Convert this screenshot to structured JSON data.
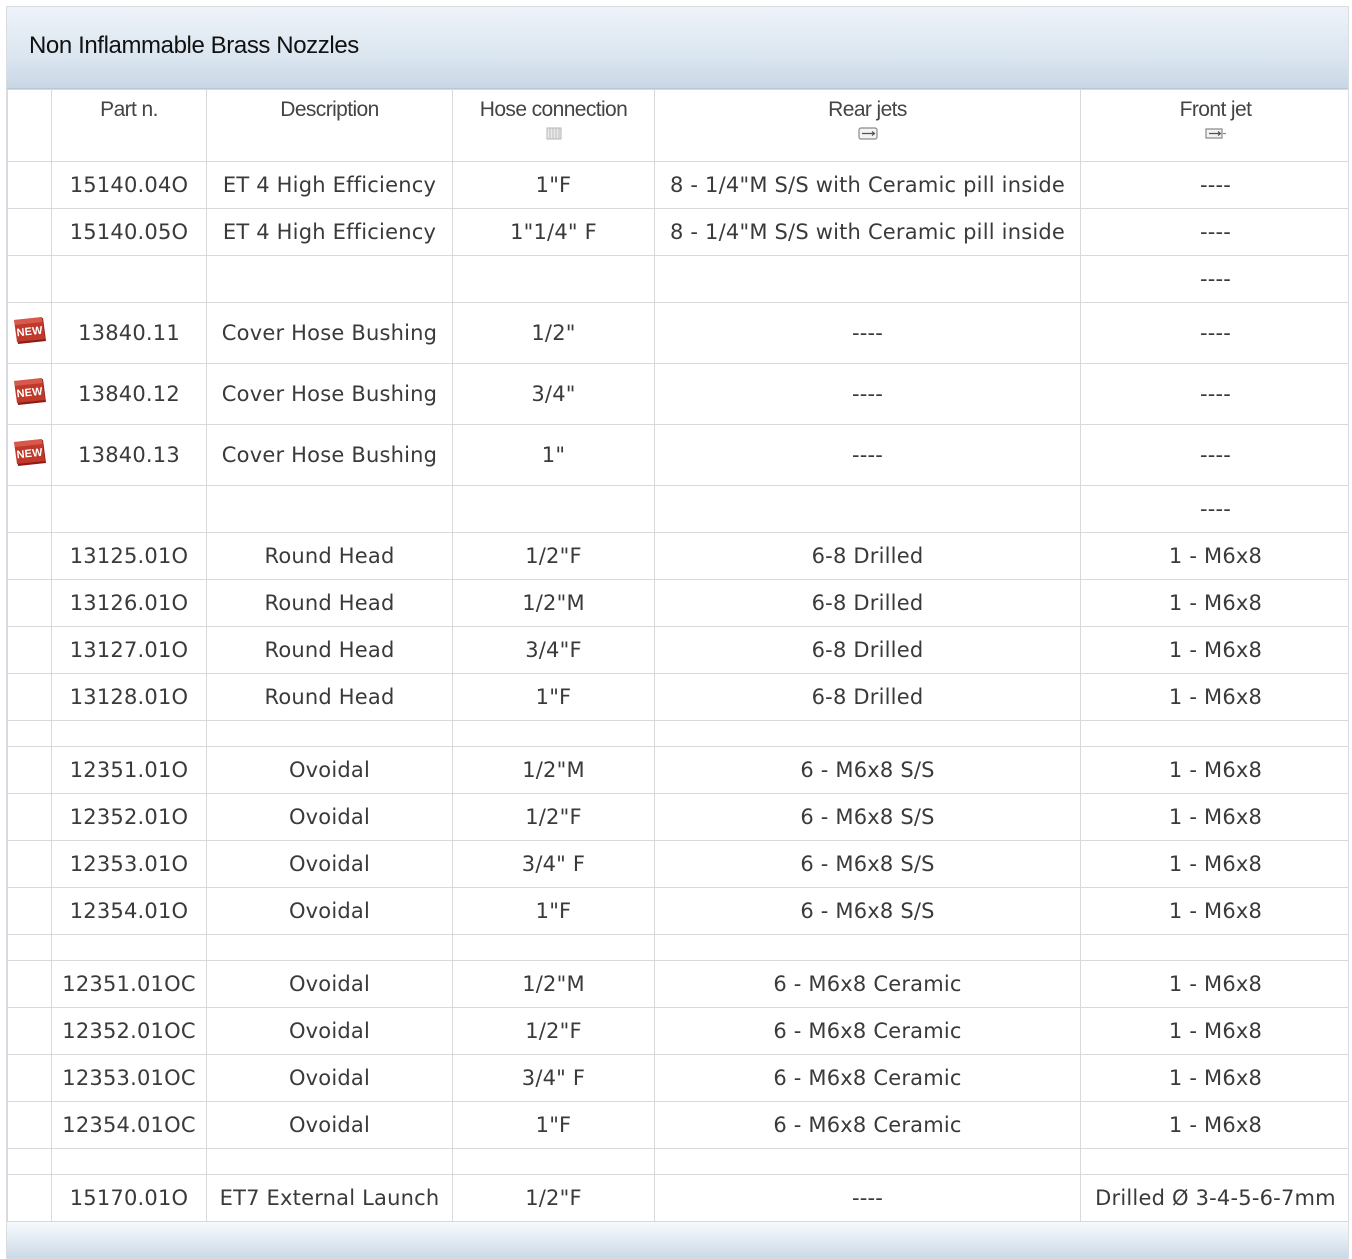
{
  "title": "Non Inflammable Brass Nozzles",
  "headers": {
    "part": "Part n.",
    "description": "Description",
    "hose": "Hose connection",
    "rear": "Rear jets",
    "front": "Front jet"
  },
  "header_icons": {
    "hose": "hose-connection-icon",
    "rear": "rear-jet-icon",
    "front": "front-jet-icon"
  },
  "badge_label": "NEW",
  "colors": {
    "badge": "#c0392b",
    "header_gradient_bottom": "#c9d7e5"
  },
  "rows": [
    {
      "kind": "data",
      "new": false,
      "part": "15140.04O",
      "desc": "ET 4 High Efficiency",
      "hose": "1\"F",
      "rear": "8 - 1/4\"M S/S with Ceramic pill inside",
      "front": "----"
    },
    {
      "kind": "data",
      "new": false,
      "part": "15140.05O",
      "desc": "ET 4 High Efficiency",
      "hose": "1\"1/4\" F",
      "rear": "8 - 1/4\"M S/S with Ceramic pill inside",
      "front": "----"
    },
    {
      "kind": "sep-big",
      "front": "----"
    },
    {
      "kind": "data",
      "tall": true,
      "new": true,
      "part": "13840.11",
      "desc": "Cover Hose Bushing",
      "hose": "1/2\"",
      "rear": "----",
      "front": "----"
    },
    {
      "kind": "data",
      "tall": true,
      "new": true,
      "part": "13840.12",
      "desc": "Cover Hose Bushing",
      "hose": "3/4\"",
      "rear": "----",
      "front": "----"
    },
    {
      "kind": "data",
      "tall": true,
      "new": true,
      "part": "13840.13",
      "desc": "Cover Hose Bushing",
      "hose": "1\"",
      "rear": "----",
      "front": "----"
    },
    {
      "kind": "sep-big",
      "front": "----"
    },
    {
      "kind": "data",
      "new": false,
      "part": "13125.01O",
      "desc": "Round Head",
      "hose": "1/2\"F",
      "rear": "6-8 Drilled",
      "front": "1 - M6x8"
    },
    {
      "kind": "data",
      "new": false,
      "part": "13126.01O",
      "desc": "Round Head",
      "hose": "1/2\"M",
      "rear": "6-8 Drilled",
      "front": "1 - M6x8"
    },
    {
      "kind": "data",
      "new": false,
      "part": "13127.01O",
      "desc": "Round Head",
      "hose": "3/4\"F",
      "rear": "6-8 Drilled",
      "front": "1 - M6x8"
    },
    {
      "kind": "data",
      "new": false,
      "part": "13128.01O",
      "desc": "Round Head",
      "hose": "1\"F",
      "rear": "6-8 Drilled",
      "front": "1 - M6x8"
    },
    {
      "kind": "sep-small"
    },
    {
      "kind": "data",
      "new": false,
      "part": "12351.01O",
      "desc": "Ovoidal",
      "hose": "1/2\"M",
      "rear": "6 - M6x8 S/S",
      "front": "1 - M6x8"
    },
    {
      "kind": "data",
      "new": false,
      "part": "12352.01O",
      "desc": "Ovoidal",
      "hose": "1/2\"F",
      "rear": "6 - M6x8 S/S",
      "front": "1 - M6x8"
    },
    {
      "kind": "data",
      "new": false,
      "part": "12353.01O",
      "desc": "Ovoidal",
      "hose": "3/4\" F",
      "rear": "6 - M6x8 S/S",
      "front": "1 - M6x8"
    },
    {
      "kind": "data",
      "new": false,
      "part": "12354.01O",
      "desc": "Ovoidal",
      "hose": "1\"F",
      "rear": "6 - M6x8 S/S",
      "front": "1 - M6x8"
    },
    {
      "kind": "sep-small"
    },
    {
      "kind": "data",
      "new": false,
      "part": "12351.01OC",
      "desc": "Ovoidal",
      "hose": "1/2\"M",
      "rear": "6 - M6x8 Ceramic",
      "front": "1 - M6x8"
    },
    {
      "kind": "data",
      "new": false,
      "part": "12352.01OC",
      "desc": "Ovoidal",
      "hose": "1/2\"F",
      "rear": "6 - M6x8 Ceramic",
      "front": "1 - M6x8"
    },
    {
      "kind": "data",
      "new": false,
      "part": "12353.01OC",
      "desc": "Ovoidal",
      "hose": "3/4\" F",
      "rear": "6 - M6x8 Ceramic",
      "front": "1 - M6x8"
    },
    {
      "kind": "data",
      "new": false,
      "part": "12354.01OC",
      "desc": "Ovoidal",
      "hose": "1\"F",
      "rear": "6 - M6x8 Ceramic",
      "front": "1 - M6x8"
    },
    {
      "kind": "sep-small"
    },
    {
      "kind": "data",
      "new": false,
      "part": "15170.01O",
      "desc": "ET7 External Launch",
      "hose": "1/2\"F",
      "rear": "----",
      "front": "Drilled Ø 3-4-5-6-7mm"
    }
  ]
}
